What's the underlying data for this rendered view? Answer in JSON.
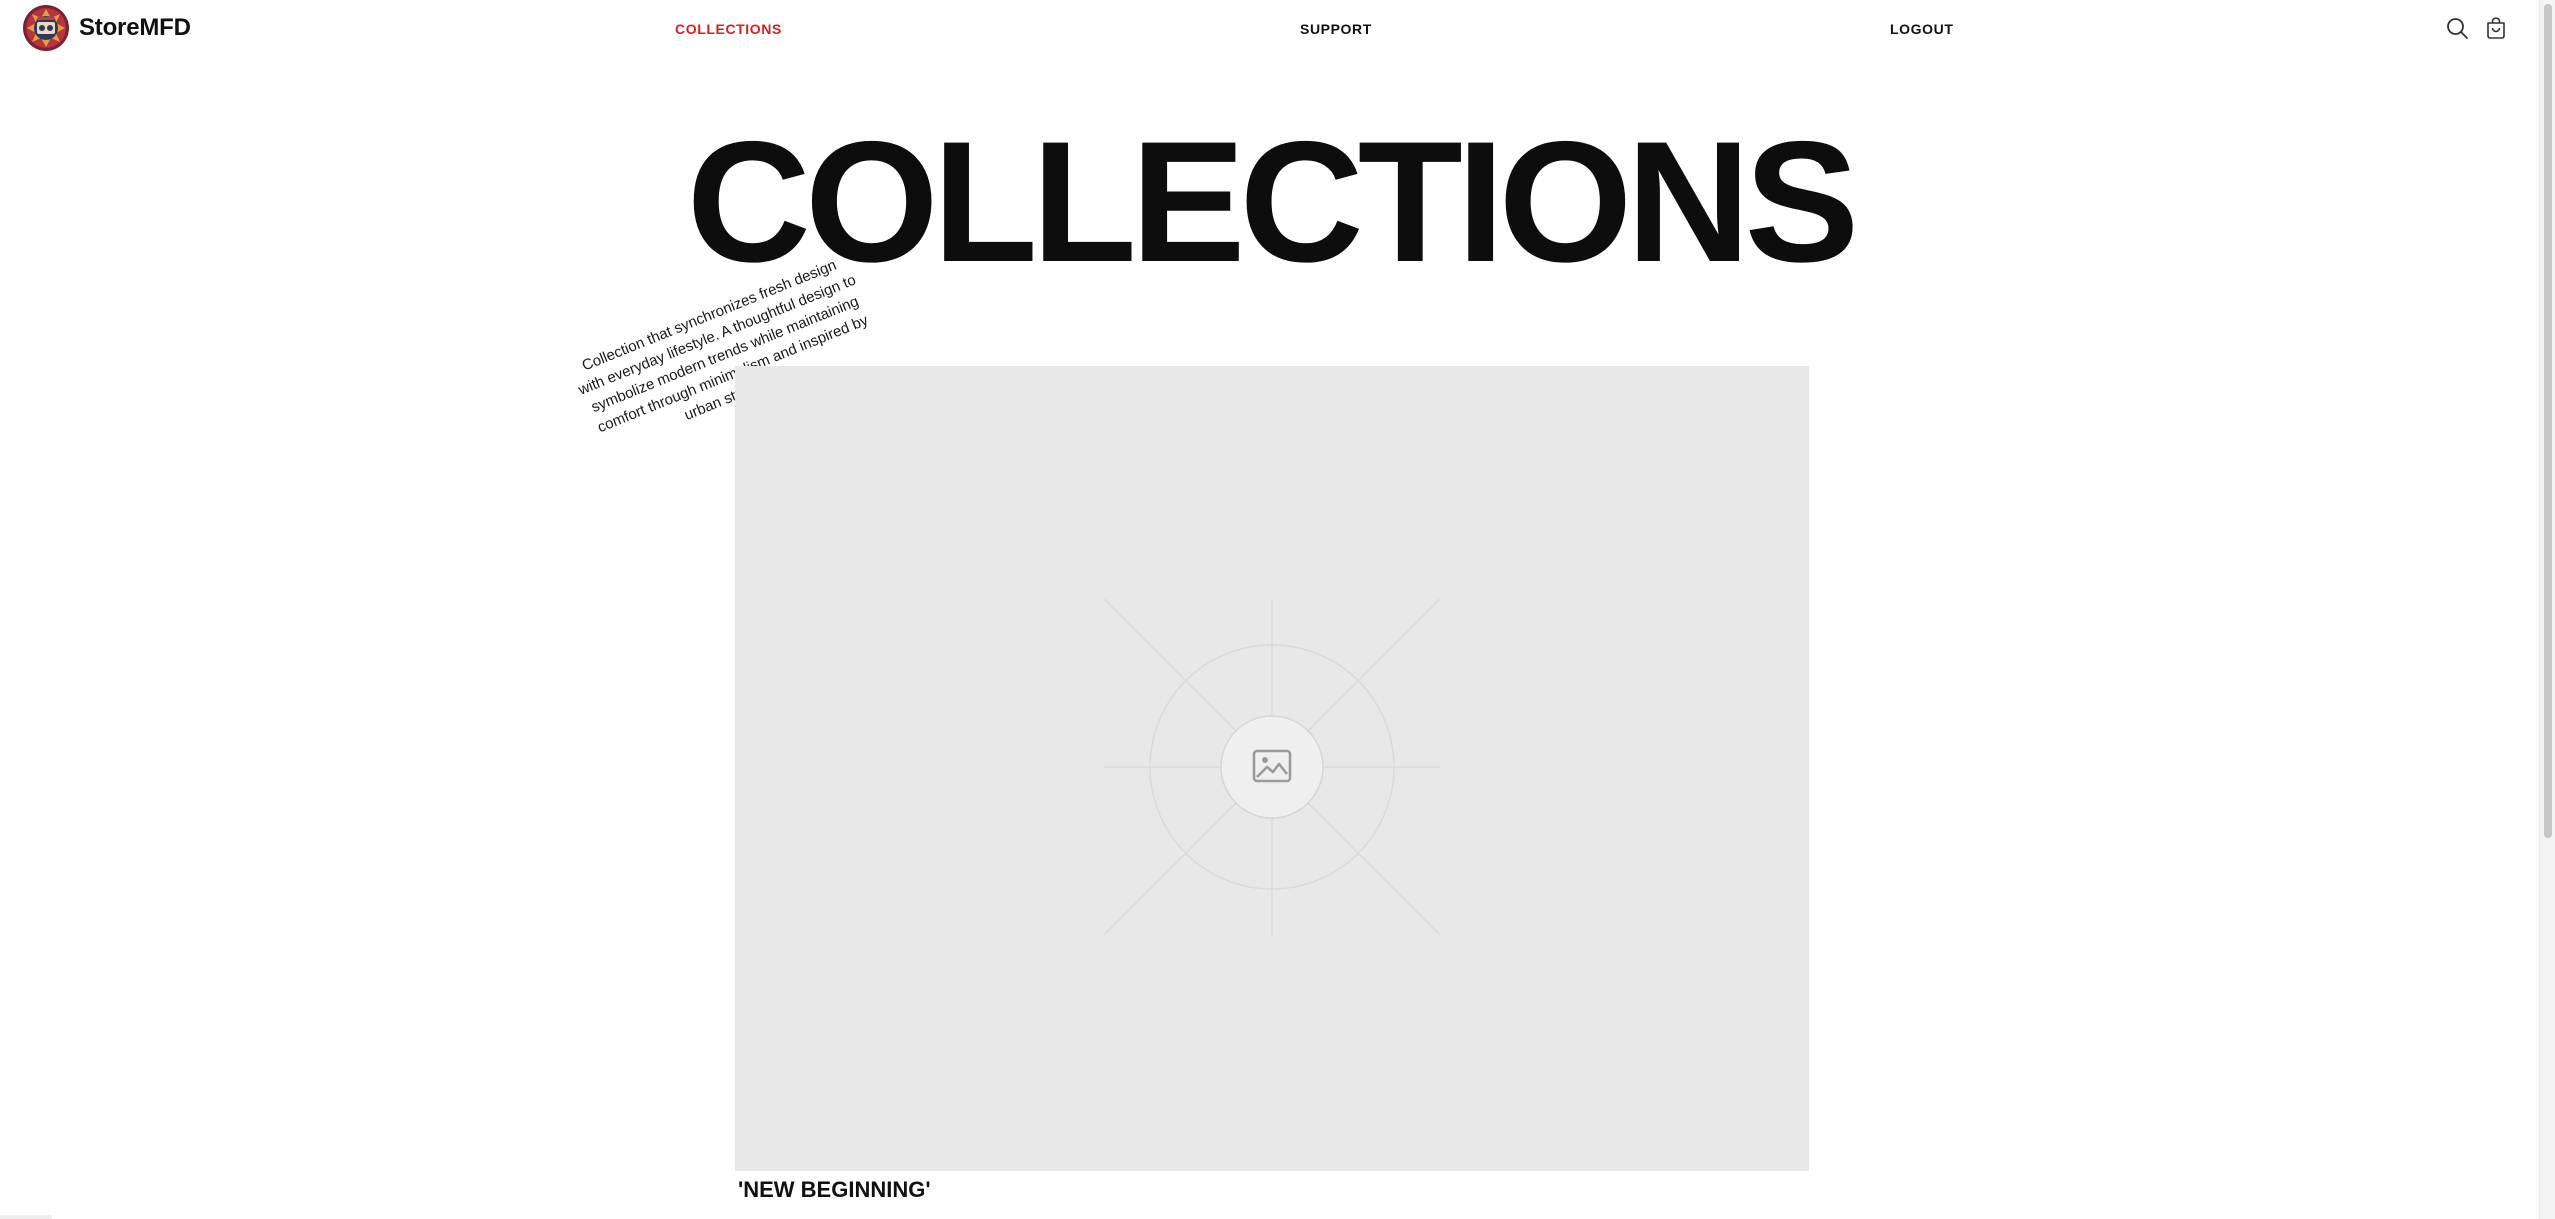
{
  "header": {
    "brand_name": "StoreMFD",
    "logo_icon": "storemfd-logo-icon",
    "nav": [
      {
        "label": "COLLECTIONS",
        "active": true
      },
      {
        "label": "SUPPORT",
        "active": false
      },
      {
        "label": "LOGOUT",
        "active": false
      }
    ],
    "icons": [
      "search-icon",
      "cart-icon"
    ]
  },
  "main": {
    "title": "COLLECTIONS",
    "description": "Collection that synchronizes fresh design with everyday lifestyle. A thoughtful design to symbolize modern trends while maintaining comfort through minimalism and inspired by urban style vision.",
    "collections": [
      {
        "name": "'NEW BEGINNING'",
        "image_icon": "image-placeholder-icon"
      }
    ]
  },
  "colors": {
    "accent": "#d81f1f",
    "text": "#111111",
    "placeholder_bg": "#e8e8e8",
    "background": "#ffffff"
  }
}
